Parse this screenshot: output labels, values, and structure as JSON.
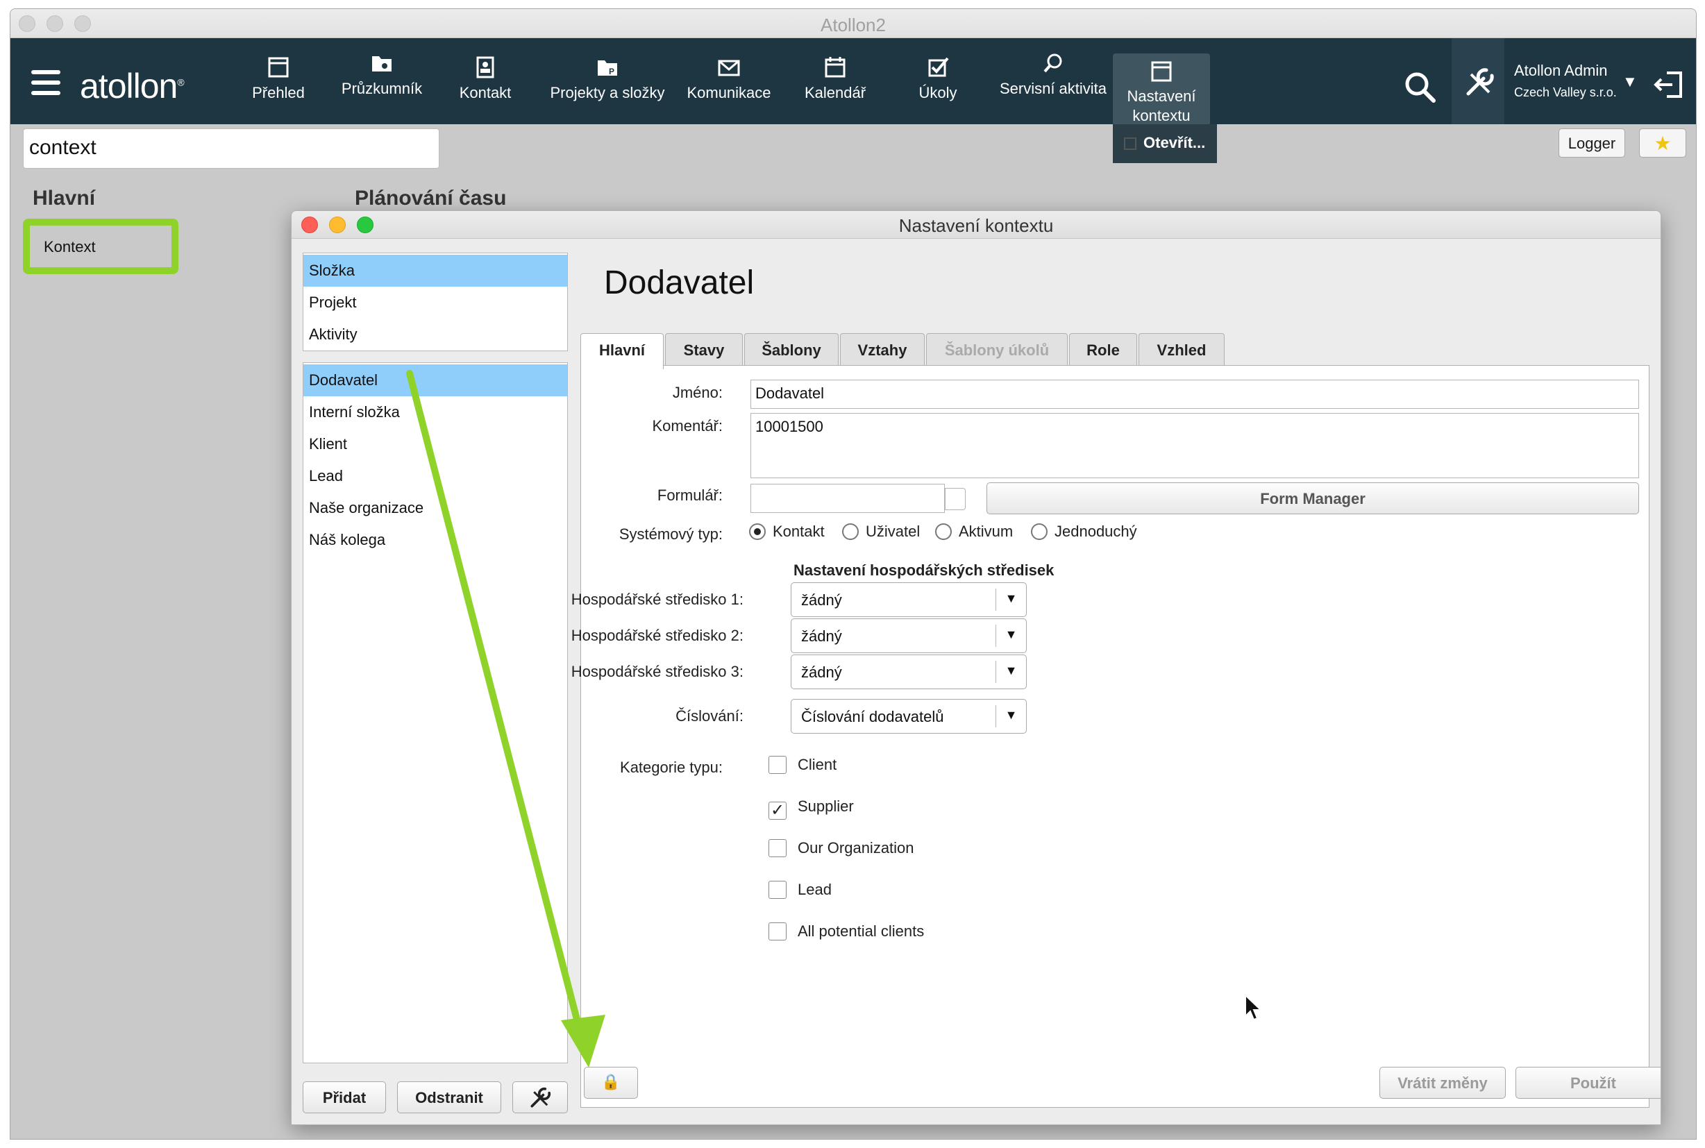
{
  "window": {
    "title": "Atollon2"
  },
  "navbar": {
    "logo": "atollon",
    "items": [
      {
        "label": "Přehled",
        "icon": "overview-icon"
      },
      {
        "label": "Průzkumník",
        "icon": "explorer-icon"
      },
      {
        "label": "Kontakt",
        "icon": "contact-icon"
      },
      {
        "label": "Projekty a složky",
        "icon": "projects-icon"
      },
      {
        "label": "Komunikace",
        "icon": "mail-icon"
      },
      {
        "label": "Kalendář",
        "icon": "calendar-icon"
      },
      {
        "label": "Úkoly",
        "icon": "tasks-icon"
      },
      {
        "label": "Servisní aktivita",
        "icon": "service-icon"
      }
    ],
    "active_item": {
      "line1": "Nastavení",
      "line2": "kontextu"
    },
    "dropdown_open": "Otevřít...",
    "user_name": "Atollon Admin",
    "user_company": "Czech Valley s.r.o.",
    "user_caret": "▼"
  },
  "toolbar": {
    "search_value": "context",
    "logger_label": "Logger",
    "star_glyph": "★"
  },
  "sidebar": {
    "section_title": "Hlavní",
    "second_section": "Plánování času",
    "item_label": "Kontext"
  },
  "dialog": {
    "title": "Nastavení kontextu",
    "heading": "Dodavatel",
    "top_list": [
      "Složka",
      "Projekt",
      "Aktivity"
    ],
    "type_list": [
      "Dodavatel",
      "Interní složka",
      "Klient",
      "Lead",
      "Naše organizace",
      "Náš kolega"
    ],
    "buttons": {
      "add": "Přidat",
      "remove": "Odstranit",
      "revert": "Vrátit změny",
      "apply": "Použít",
      "lock_glyph": "🔒"
    },
    "tabs": [
      "Hlavní",
      "Stavy",
      "Šablony",
      "Vztahy",
      "Šablony úkolů",
      "Role",
      "Vzhled"
    ],
    "form": {
      "name_label": "Jméno:",
      "name_value": "Dodavatel",
      "comment_label": "Komentář:",
      "comment_value": "10001500",
      "form_label": "Formulář:",
      "form_manager": "Form Manager",
      "system_type_label": "Systémový typ:",
      "system_types": [
        "Kontakt",
        "Uživatel",
        "Aktivum",
        "Jednoduchý"
      ],
      "system_type_selected": "Kontakt",
      "cost_center_title": "Nastavení hospodářských středisek",
      "cost_centers": [
        {
          "label": "Hospodářské středisko 1:",
          "value": "žádný"
        },
        {
          "label": "Hospodářské středisko 2:",
          "value": "žádný"
        },
        {
          "label": "Hospodářské středisko 3:",
          "value": "žádný"
        }
      ],
      "numbering_label": "Číslování:",
      "numbering_value": "Číslování dodavatelů",
      "category_label": "Kategorie typu:",
      "categories": [
        {
          "label": "Client",
          "checked": false
        },
        {
          "label": "Supplier",
          "checked": true
        },
        {
          "label": "Our Organization",
          "checked": false
        },
        {
          "label": "Lead",
          "checked": false
        },
        {
          "label": "All potential clients",
          "checked": false
        }
      ],
      "check_glyph": "✓",
      "caret_glyph": "▼"
    }
  },
  "colors": {
    "navbar": "#1d3642",
    "selection": "#8fcdfa",
    "highlight": "#8fd32a",
    "annotation_arrow": "#8fd32a"
  }
}
